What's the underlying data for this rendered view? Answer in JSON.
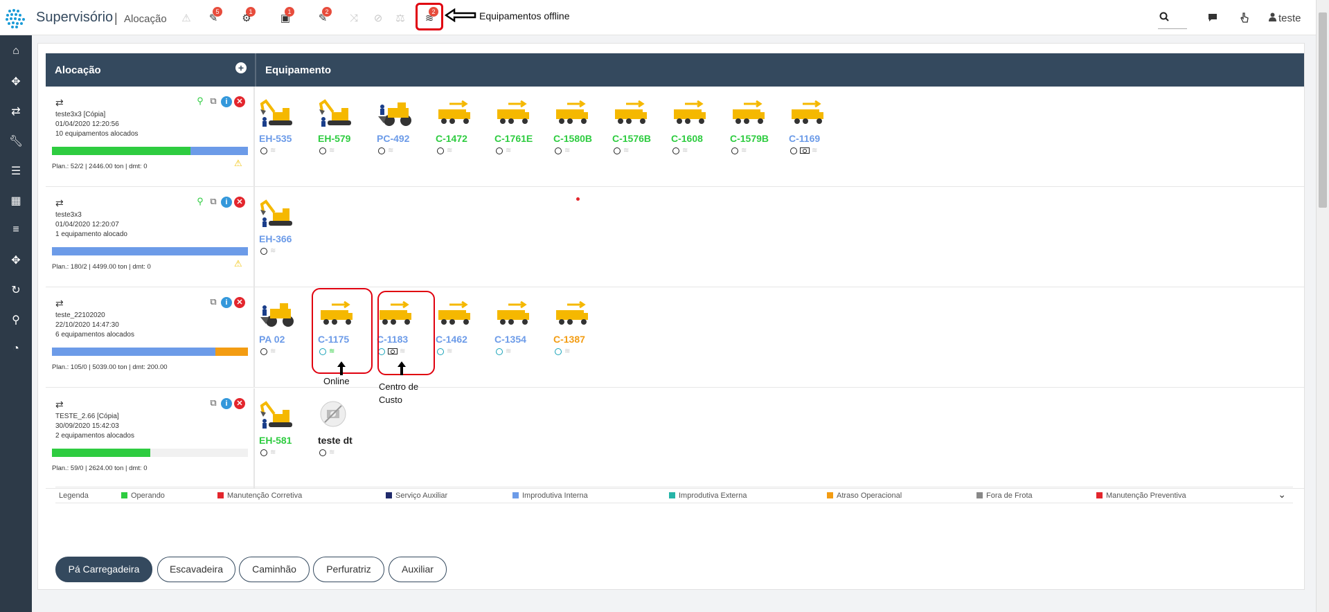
{
  "app": {
    "title": "Supervisório",
    "separator": "|",
    "page": "Alocação",
    "user": "teste"
  },
  "toolbar": {
    "icons": [
      {
        "name": "alert-icon",
        "badge": ""
      },
      {
        "name": "tools-alert-icon",
        "badge": "5"
      },
      {
        "name": "parts-icon",
        "badge": "1"
      },
      {
        "name": "inbox-icon",
        "badge": "1"
      },
      {
        "name": "wrench-icon",
        "badge": "2"
      },
      {
        "name": "shuffle-icon",
        "badge": ""
      },
      {
        "name": "block-icon",
        "badge": ""
      },
      {
        "name": "balance-icon",
        "badge": ""
      },
      {
        "name": "offline-rss-icon",
        "badge": "2"
      }
    ],
    "offline_note": "Equipamentos offline"
  },
  "header": {
    "alocacao": "Alocação",
    "equipamento": "Equipamento"
  },
  "allocations": [
    {
      "name": "teste3x3 [Cópia]",
      "date": "01/04/2020 12:20:56",
      "count": "10 equipamentos alocados",
      "plan": "Plan.: 52/2 | 2446.00 ton | dmt: 0",
      "warning": true,
      "progress": [
        {
          "color": "#2ecc40",
          "pct": 70.5
        },
        {
          "color": "#6c9be8",
          "pct": 29.5
        }
      ],
      "equipment": [
        {
          "name": "EH-535",
          "color": "blue",
          "type": "excavator",
          "offline": true
        },
        {
          "name": "EH-579",
          "color": "green",
          "type": "excavator",
          "offline": true
        },
        {
          "name": "PC-492",
          "color": "blue",
          "type": "loader",
          "offline": true
        },
        {
          "name": "C-1472",
          "color": "green",
          "type": "truck",
          "offline": true
        },
        {
          "name": "C-1761E",
          "color": "green",
          "type": "truck",
          "offline": true
        },
        {
          "name": "C-1580B",
          "color": "green",
          "type": "truck",
          "offline": true
        },
        {
          "name": "C-1576B",
          "color": "green",
          "type": "truck",
          "offline": true
        },
        {
          "name": "C-1608",
          "color": "green",
          "type": "truck",
          "offline": true
        },
        {
          "name": "C-1579B",
          "color": "green",
          "type": "truck",
          "offline": true
        },
        {
          "name": "C-1169",
          "color": "blue",
          "type": "truck",
          "offline": true,
          "cost": true
        }
      ]
    },
    {
      "name": "teste3x3",
      "date": "01/04/2020 12:20:07",
      "count": "1 equipamento alocado",
      "plan": "Plan.: 180/2 | 4499.00 ton | dmt: 0",
      "warning": true,
      "progress": [
        {
          "color": "#6c9be8",
          "pct": 100
        }
      ],
      "equipment": [
        {
          "name": "EH-366",
          "color": "blue",
          "type": "excavator",
          "offline": true
        }
      ]
    },
    {
      "name": "teste_22102020",
      "date": "22/10/2020 14:47:30",
      "count": "6 equipamentos alocados",
      "plan": "Plan.: 105/0 | 5039.00 ton | dmt: 200.00",
      "warning": false,
      "progress": [
        {
          "color": "#6c9be8",
          "pct": 83.5
        },
        {
          "color": "#f39c12",
          "pct": 16.5
        }
      ],
      "equipment": [
        {
          "name": "PA 02",
          "color": "blue",
          "type": "loader",
          "offline": true
        },
        {
          "name": "C-1175",
          "color": "blue",
          "type": "truck",
          "offline": false,
          "cyan": true
        },
        {
          "name": "C-1183",
          "color": "blue",
          "type": "truck",
          "offline": true,
          "cyan": true,
          "cost": true
        },
        {
          "name": "C-1462",
          "color": "blue",
          "type": "truck",
          "offline": true,
          "cyan": true
        },
        {
          "name": "C-1354",
          "color": "blue",
          "type": "truck",
          "offline": true,
          "cyan": true
        },
        {
          "name": "C-1387",
          "color": "orange",
          "type": "truck",
          "offline": true,
          "cyan": true
        }
      ]
    },
    {
      "name": "TESTE_2.66 [Cópia]",
      "date": "30/09/2020 15:42:03",
      "count": "2 equipamentos alocados",
      "plan": "Plan.: 59/0 | 2624.00 ton | dmt: 0",
      "warning": false,
      "progress": [
        {
          "color": "#2ecc40",
          "pct": 50
        }
      ],
      "equipment": [
        {
          "name": "EH-581",
          "color": "green",
          "type": "excavator",
          "offline": true
        },
        {
          "name": "teste dt",
          "color": "dark",
          "type": "nophoto",
          "offline": true
        }
      ]
    }
  ],
  "annotations": {
    "online": "Online",
    "centro": "Centro de",
    "custo": "Custo"
  },
  "legend": {
    "title": "Legenda",
    "items": [
      {
        "label": "Operando",
        "color": "#2ecc40"
      },
      {
        "label": "Manutenção Corretiva",
        "color": "#e3262d"
      },
      {
        "label": "Serviço Auxiliar",
        "color": "#1f2a6b"
      },
      {
        "label": "Improdutiva Interna",
        "color": "#6c9be8"
      },
      {
        "label": "Improdutiva Externa",
        "color": "#26b5a8"
      },
      {
        "label": "Atraso Operacional",
        "color": "#f39c12"
      },
      {
        "label": "Fora de Frota",
        "color": "#888888"
      },
      {
        "label": "Manutenção Preventiva",
        "color": "#e3262d"
      }
    ]
  },
  "tabs": [
    "Pá Carregadeira",
    "Escavadeira",
    "Caminhão",
    "Perfuratriz",
    "Auxiliar"
  ],
  "active_tab": 0
}
